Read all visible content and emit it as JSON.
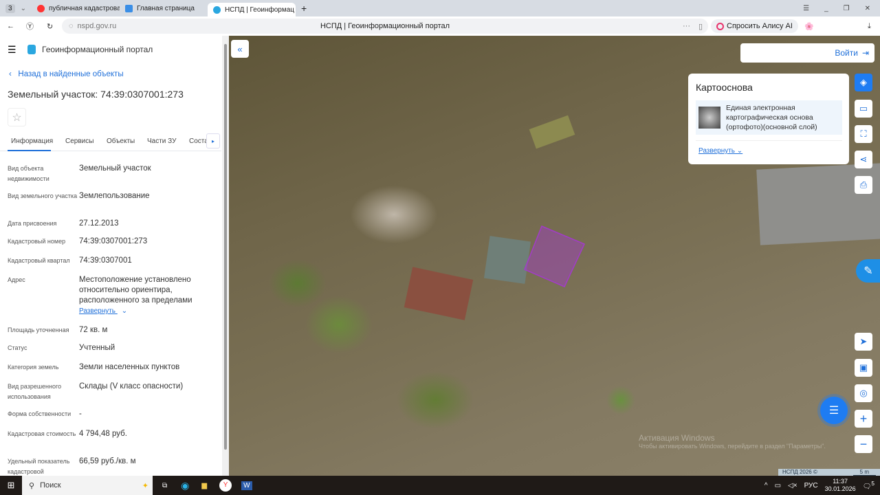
{
  "browser": {
    "tab_count": "3",
    "tabs": [
      {
        "label": "публичная кадастровая"
      },
      {
        "label": "Главная страница"
      },
      {
        "label": "НСПД | Геоинформац"
      }
    ],
    "url": "nspd.gov.ru",
    "page_title": "НСПД | Геоинформационный портал",
    "alice_label": "Спросить Алису AI"
  },
  "header": {
    "title": "Геоинформационный портал"
  },
  "panel": {
    "back_link": "Назад в найденные объекты",
    "object_title": "Земельный участок: 74:39:0307001:273",
    "tabs": [
      {
        "label": "Информация"
      },
      {
        "label": "Сервисы"
      },
      {
        "label": "Объекты"
      },
      {
        "label": "Части ЗУ"
      },
      {
        "label": "Соста"
      }
    ],
    "expand_label": "Развернуть",
    "fields": [
      {
        "label": "Вид объекта недвижимости",
        "value": "Земельный участок"
      },
      {
        "label": "Вид земельного участка",
        "value": "Землепользование"
      },
      {
        "label": "Дата присвоения",
        "value": "27.12.2013"
      },
      {
        "label": "Кадастровый номер",
        "value": "74:39:0307001:273"
      },
      {
        "label": "Кадастровый квартал",
        "value": "74:39:0307001"
      },
      {
        "label": "Адрес",
        "value": "Местоположение установлено относительно ориентира, расположенного за пределами"
      },
      {
        "label": "Площадь уточненная",
        "value": "72 кв. м"
      },
      {
        "label": "Статус",
        "value": "Учтенный"
      },
      {
        "label": "Категория земель",
        "value": "Земли населенных пунктов"
      },
      {
        "label": "Вид разрешенного использования",
        "value": "Склады (V класс опасности)"
      },
      {
        "label": "Форма собственности",
        "value": "-"
      },
      {
        "label": "Кадастровая стоимость",
        "value": "4 794,48 руб."
      },
      {
        "label": "Удельный показатель кадастровой",
        "value": "66,59 руб./кв. м"
      }
    ]
  },
  "map": {
    "login_label": "Войти",
    "basemap": {
      "title": "Картооснова",
      "layer": "Единая электронная картографическая основа (ортофото)(основной слой)",
      "expand_label": "Развернуть"
    },
    "attribution": "НСПД 2026 ©",
    "scale": "5 m",
    "watermark_title": "Активация Windows",
    "watermark_text": "Чтобы активировать Windows, перейдите в раздел \"Параметры\".",
    "parcel_color": "#a23cc8"
  },
  "taskbar": {
    "search": "Поиск",
    "lang": "РУС",
    "time": "11:37",
    "date": "30.01.2026",
    "notifications": "5"
  }
}
